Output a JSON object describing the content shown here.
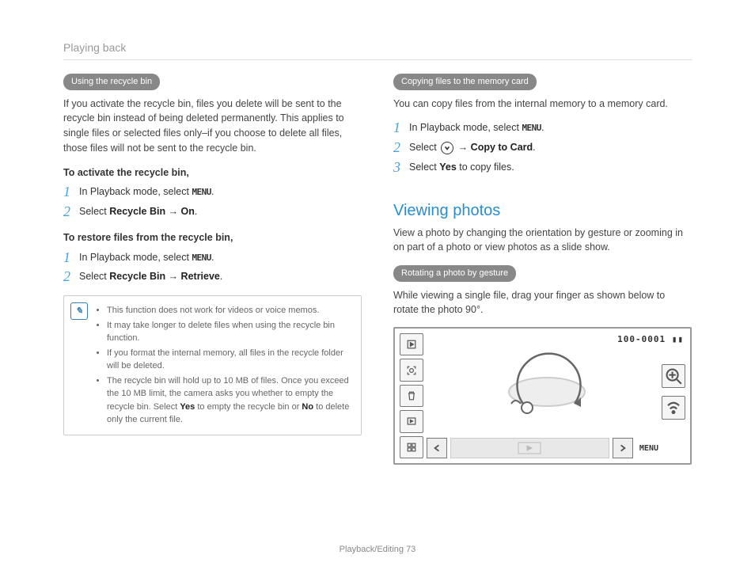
{
  "header": "Playing back",
  "left": {
    "pill1": "Using the recycle bin",
    "intro": "If you activate the recycle bin, files you delete will be sent to the recycle bin instead of being deleted permanently. This applies to single files or selected files only–if you choose to delete all files, those files will not be sent to the recycle bin.",
    "sub1": "To activate the recycle bin,",
    "s1_1a": "In Playback mode, select ",
    "menu": "MENU",
    "dot": ".",
    "s1_2a": "Select ",
    "s1_2b": "Recycle Bin",
    "arrow": " → ",
    "s1_2c": "On",
    "sub2": "To restore files from the recycle bin,",
    "s2_1a": "In Playback mode, select ",
    "s2_2a": "Select ",
    "s2_2b": "Recycle Bin",
    "s2_2c": "Retrieve",
    "note1": "This function does not work for videos or voice memos.",
    "note2": "It may take longer to delete files when using the recycle bin function.",
    "note3": "If you format the internal memory, all files in the recycle folder will be deleted.",
    "note4a": "The recycle bin will hold up to 10 MB of files. Once you exceed the 10 MB limit, the camera asks you whether to empty the recycle bin. Select ",
    "note4b": "Yes",
    "note4c": " to empty the recycle bin or ",
    "note4d": "No",
    "note4e": " to delete only the current file."
  },
  "right": {
    "pill2": "Copying files to the memory card",
    "intro2": "You can copy files from the internal memory to a memory card.",
    "r1a": "In Playback mode, select ",
    "r2a": "Select ",
    "r2b": "Copy to Card",
    "r3a": "Select ",
    "r3b": "Yes",
    "r3c": " to copy files.",
    "h2": "Viewing photos",
    "h2desc": "View a photo by changing the orientation by gesture or zooming in on part of a photo or view photos as a slide show.",
    "pill3": "Rotating a photo by gesture",
    "rotdesc": "While viewing a single file, drag your finger as shown below to rotate the photo 90°.",
    "counter": "100-0001",
    "screen_menu": "MENU"
  },
  "footer_label": "Playback/Editing",
  "footer_page": "73"
}
